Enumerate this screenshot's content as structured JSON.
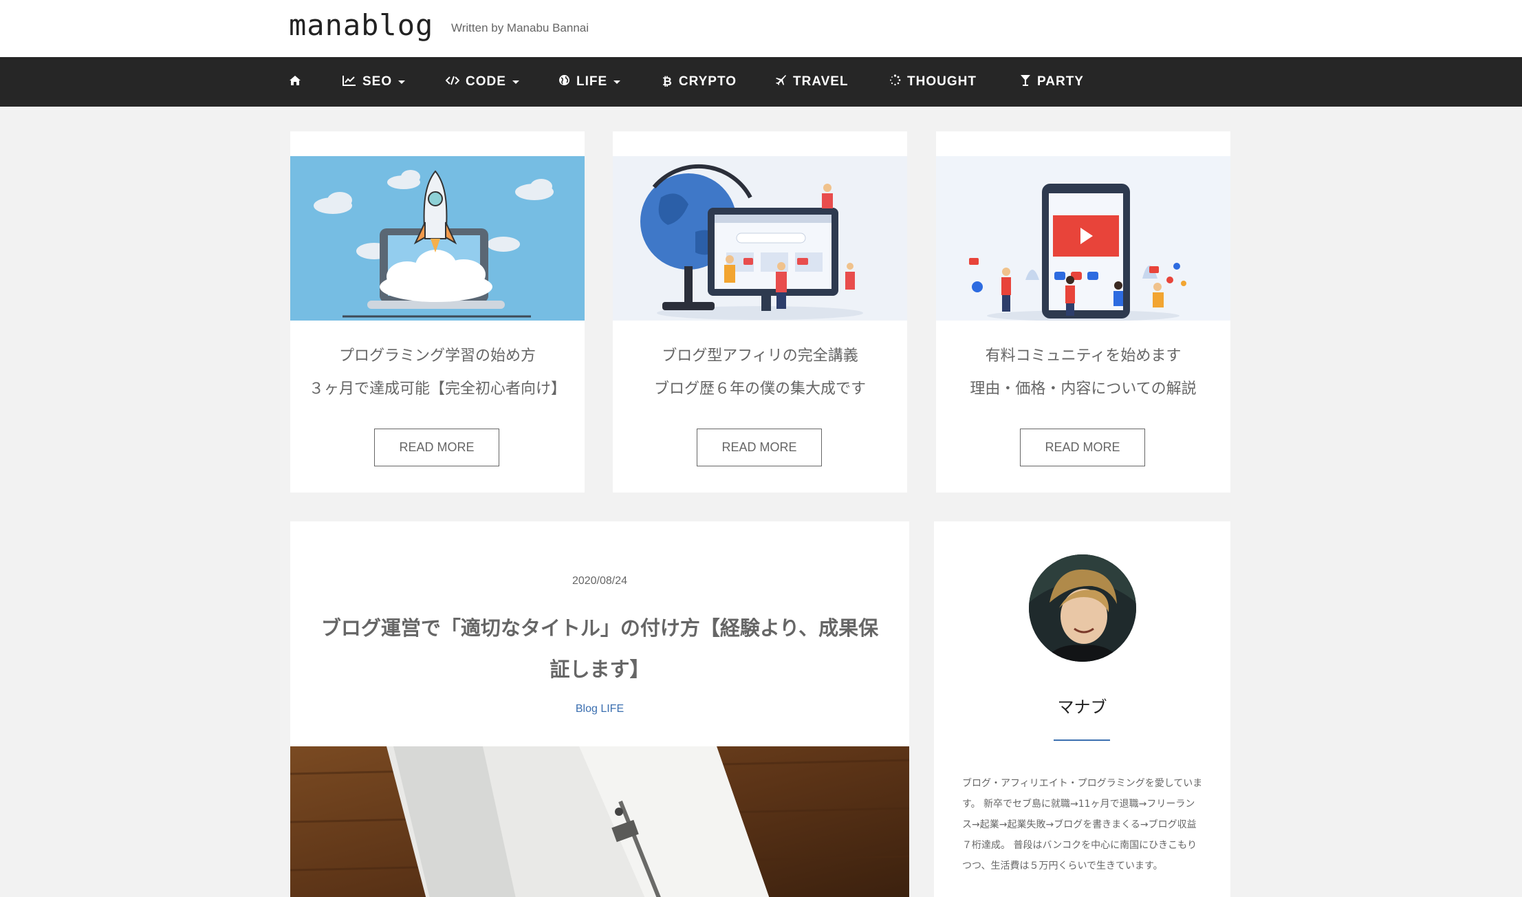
{
  "header": {
    "logo": "manablog",
    "tagline": "Written by Manabu Bannai"
  },
  "nav": {
    "items": [
      {
        "label": "",
        "icon": "home-icon"
      },
      {
        "label": "SEO",
        "icon": "chart-line-icon",
        "dropdown": true
      },
      {
        "label": "CODE",
        "icon": "code-icon",
        "dropdown": true
      },
      {
        "label": "LIFE",
        "icon": "globe-icon",
        "dropdown": true
      },
      {
        "label": "CRYPTO",
        "icon": "bitcoin-icon"
      },
      {
        "label": "TRAVEL",
        "icon": "plane-icon"
      },
      {
        "label": "THOUGHT",
        "icon": "spinner-icon"
      },
      {
        "label": "PARTY",
        "icon": "cocktail-icon"
      }
    ]
  },
  "cards": [
    {
      "line1": "プログラミング学習の始め方",
      "line2": "３ヶ月で達成可能【完全初心者向け】",
      "button": "READ MORE",
      "image": "rocket-laptop-illustration"
    },
    {
      "line1": "ブログ型アフィリの完全講義",
      "line2": "ブログ歴６年の僕の集大成です",
      "button": "READ MORE",
      "image": "globe-monitor-illustration"
    },
    {
      "line1": "有料コミュニティを始めます",
      "line2": "理由・価格・内容についての解説",
      "button": "READ MORE",
      "image": "phone-video-illustration"
    }
  ],
  "article": {
    "date": "2020/08/24",
    "title": "ブログ運営で「適切なタイトル」の付け方【経験より、成果保証します】",
    "category": "Blog LIFE"
  },
  "profile": {
    "name": "マナブ",
    "bio": "ブログ・アフィリエイト・プログラミングを愛しています。 新卒でセブ島に就職→11ヶ月で退職→フリーランス→起業→起業失敗→ブログを書きまくる→ブログ収益７桁達成。 普段はバンコクを中心に南国にひきこもりつつ、生活費は５万円くらいで生きています。"
  },
  "colors": {
    "nav_bg": "#262626",
    "page_bg": "#f2f2f2",
    "accent": "#3b6fb0"
  }
}
